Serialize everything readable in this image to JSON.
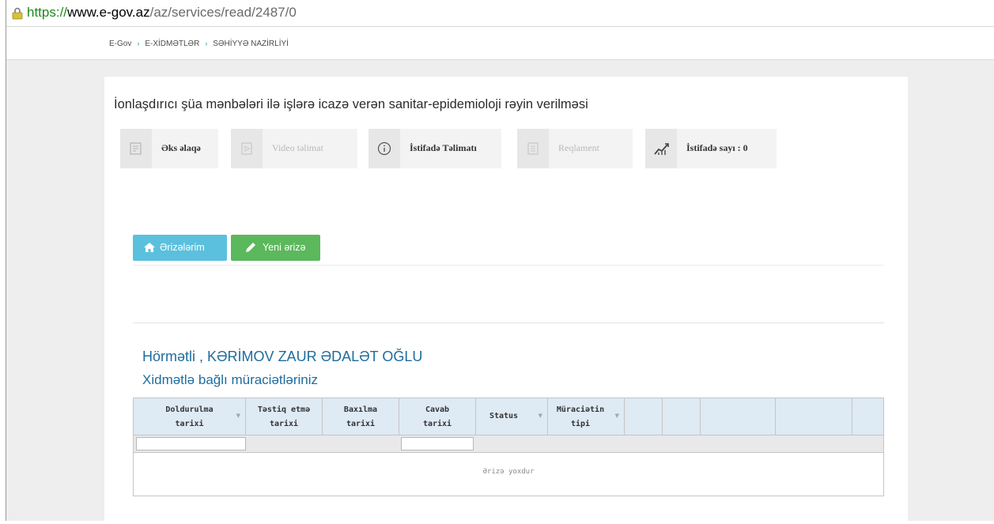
{
  "browser": {
    "url_scheme": "https://",
    "url_host": "www.e-gov.az",
    "url_path": "/az/services/read/2487/0"
  },
  "breadcrumb": [
    "E-Gov",
    "E-XİDMƏTLƏR",
    "SƏHİYYƏ NAZİRLİYİ"
  ],
  "breadcrumb_separator": "›",
  "page_title": "İonlaşdırıcı şüa mənbələri ilə işlərə icazə verən sanitar-epidemioloji rəyin verilməsi",
  "tiles": [
    {
      "label": "Əks əlaqə",
      "icon": "feedback-icon",
      "enabled": true
    },
    {
      "label": "Video təlimat",
      "icon": "video-icon",
      "enabled": false
    },
    {
      "label": "İstifadə Təlimatı",
      "icon": "info-icon",
      "enabled": true
    },
    {
      "label": "Reqlament",
      "icon": "document-icon",
      "enabled": false
    },
    {
      "label": "İstifadə sayı : 0",
      "icon": "chart-icon",
      "enabled": true
    }
  ],
  "buttons": {
    "my_applications": "Ərizələrim",
    "new_application": "Yeni ərizə"
  },
  "greeting": "Hörmətli , KƏRİMOV ZAUR ƏDALƏT OĞLU",
  "subheading": "Xidmətlə bağlı müraciətləriniz",
  "table": {
    "columns": [
      {
        "label": "Doldurulma tarixi",
        "sortable": true
      },
      {
        "label": "Təstiq etmə tarixi",
        "sortable": false
      },
      {
        "label": "Baxılma tarixi",
        "sortable": false
      },
      {
        "label": "Cavab tarixi",
        "sortable": false
      },
      {
        "label": "Status",
        "sortable": true
      },
      {
        "label": "Müraciətin tipi",
        "sortable": true
      },
      {
        "label": "",
        "sortable": false
      },
      {
        "label": "",
        "sortable": false
      },
      {
        "label": "",
        "sortable": false
      },
      {
        "label": "",
        "sortable": false
      },
      {
        "label": "",
        "sortable": false
      }
    ],
    "empty_text": "Ərizə yoxdur"
  },
  "colors": {
    "accent_blue": "#5bc0de",
    "accent_green": "#5cb85c",
    "heading_blue": "#1f6c9c",
    "header_bg": "#deeaf4"
  }
}
